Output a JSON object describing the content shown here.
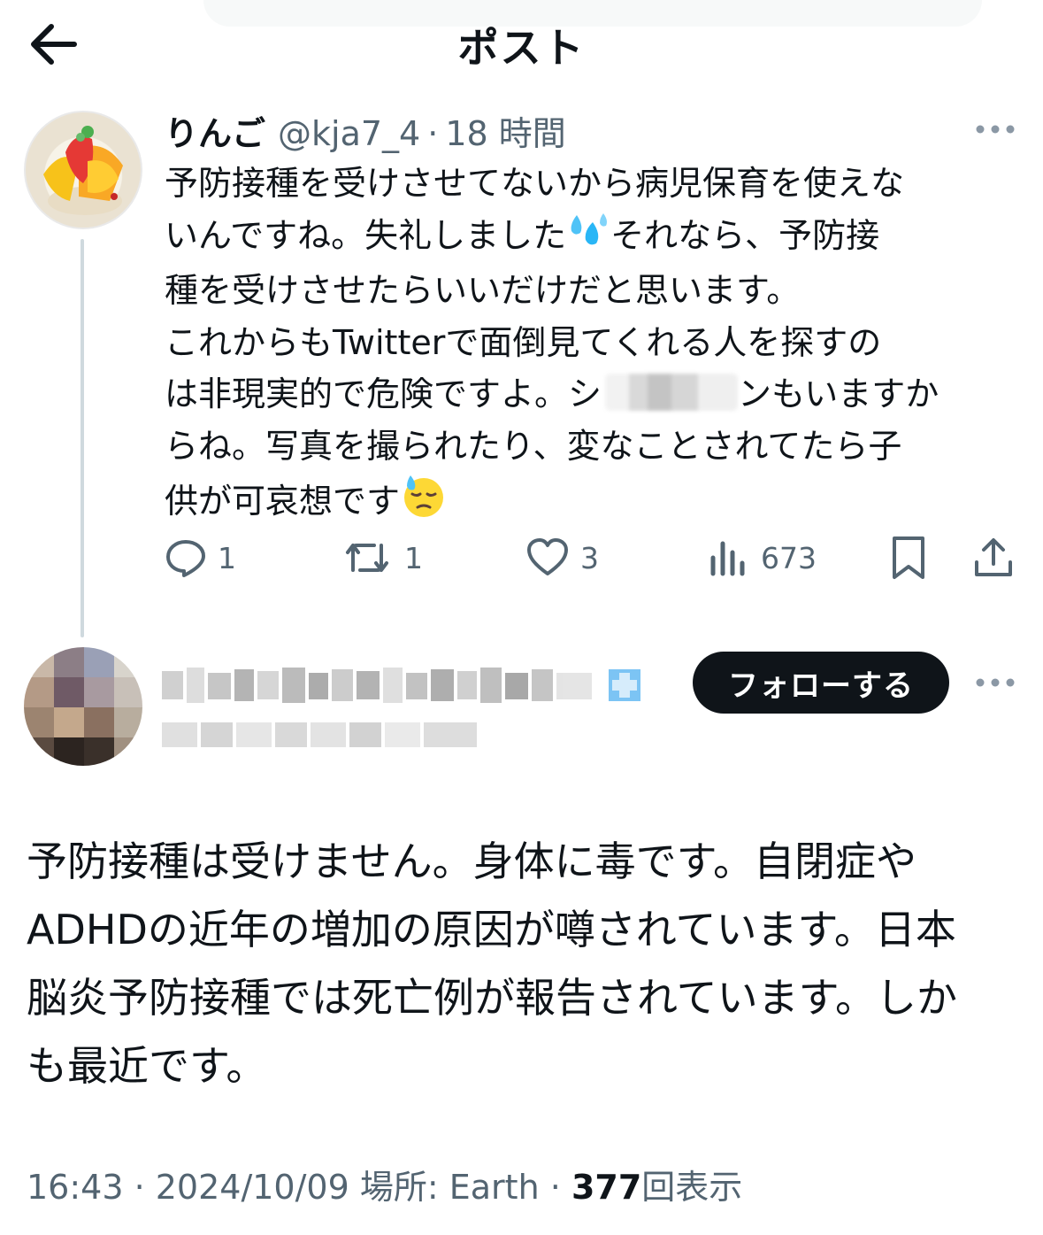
{
  "header": {
    "title": "ポスト",
    "back_icon": "arrow-left-icon"
  },
  "parent_tweet": {
    "display_name": "りんご",
    "handle": "@kja7_4",
    "separator": "·",
    "time_ago": "18 時間",
    "text_part1": "予防接種を受けさせてないから病児保育を使えな\nいんですね。失礼しました",
    "emoji1": "sweat-droplets-emoji",
    "text_part2": "それなら、予防接\n種を受けさせたらいいだけだと思います。\nこれからもTwitterで面倒見てくれる人を探すの\nは非現実的で危険ですよ。シ",
    "text_part3": "ンもいますか\nらね。写真を撮られたり、変なことされてたら子\n供が可哀想です",
    "emoji2": "downcast-face-with-sweat-emoji",
    "actions": {
      "replies": "1",
      "retweets": "1",
      "likes": "3",
      "views": "673"
    }
  },
  "reply_tweet": {
    "follow_label": "フォローする",
    "text": "予防接種は受けません。身体に毒です。自閉症や\nADHDの近年の増加の原因が噂されています。日本\n脳炎予防接種では死亡例が報告されています。しか\nも最近です。",
    "timestamp": "16:43 · 2024/10/09",
    "location": "場所: Earth",
    "separator": "·",
    "view_count": "377",
    "view_label": "回表示"
  },
  "colors": {
    "text": "#0f1419",
    "muted": "#536471",
    "button": "#0f1419",
    "verified": "#1d9bf0"
  }
}
